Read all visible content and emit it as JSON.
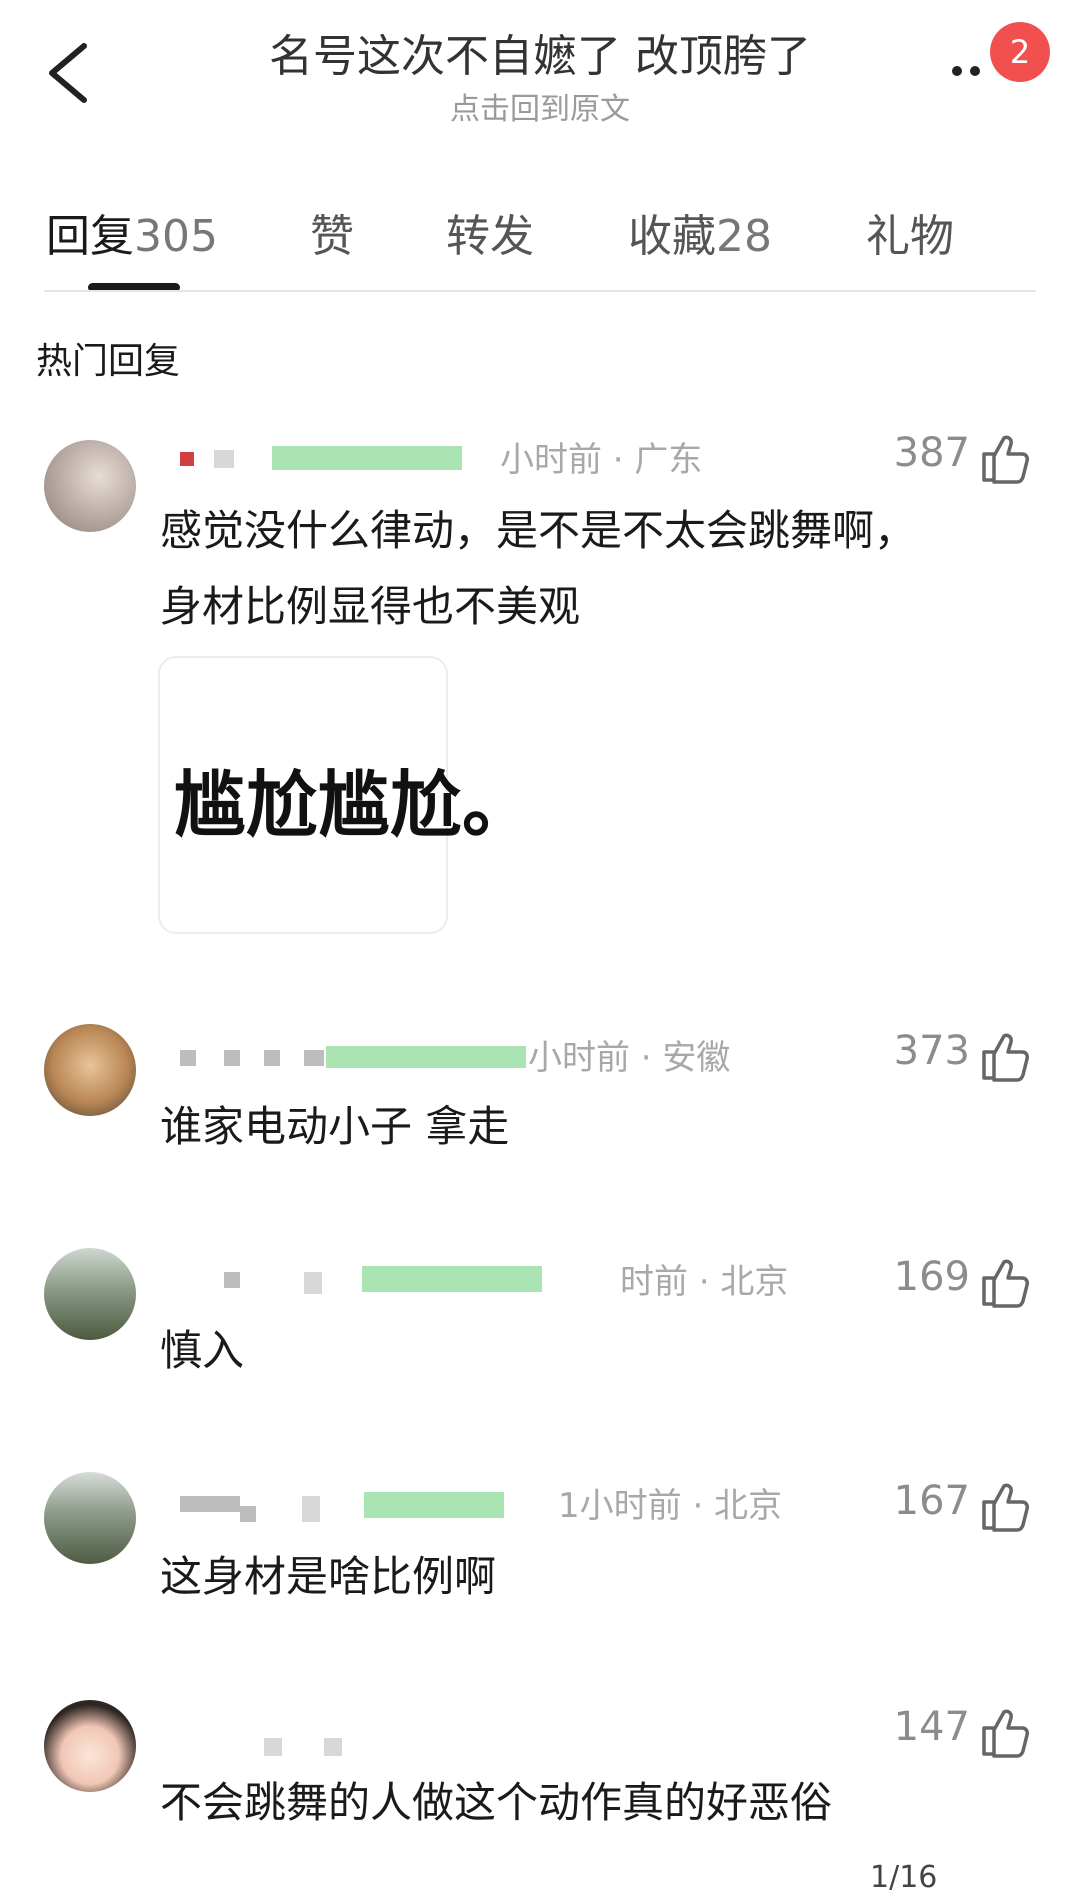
{
  "header": {
    "title": "名号这次不自嬷了 改顶胯了",
    "subtitle": "点击回到原文",
    "badge_count": "2",
    "icons": [
      "back-chevron-icon",
      "more-dots-icon"
    ]
  },
  "tabs": [
    {
      "label": "回复",
      "count": "305",
      "active": true
    },
    {
      "label": "赞",
      "count": ""
    },
    {
      "label": "转发",
      "count": ""
    },
    {
      "label": "收藏",
      "count": "28"
    },
    {
      "label": "礼物",
      "count": ""
    }
  ],
  "section_title": "热门回复",
  "comments": [
    {
      "meta": "小时前 · 广东",
      "likes": "387",
      "text_lines": [
        "感觉没什么律动，是不是不太会跳舞啊，",
        "身材比例显得也不美观"
      ],
      "sticker": "尴尬尴尬。"
    },
    {
      "meta": "小时前 · 安徽",
      "likes": "373",
      "text_lines": [
        "谁家电动小子 拿走"
      ]
    },
    {
      "meta": "时前 · 北京",
      "likes": "169",
      "text_lines": [
        "慎入"
      ]
    },
    {
      "meta": "1小时前 · 北京",
      "likes": "167",
      "text_lines": [
        "这身材是啥比例啊"
      ]
    },
    {
      "meta": "",
      "likes": "147",
      "text_lines": [
        "不会跳舞的人做这个动作真的好恶俗"
      ]
    }
  ],
  "page_indicator": "1/16"
}
